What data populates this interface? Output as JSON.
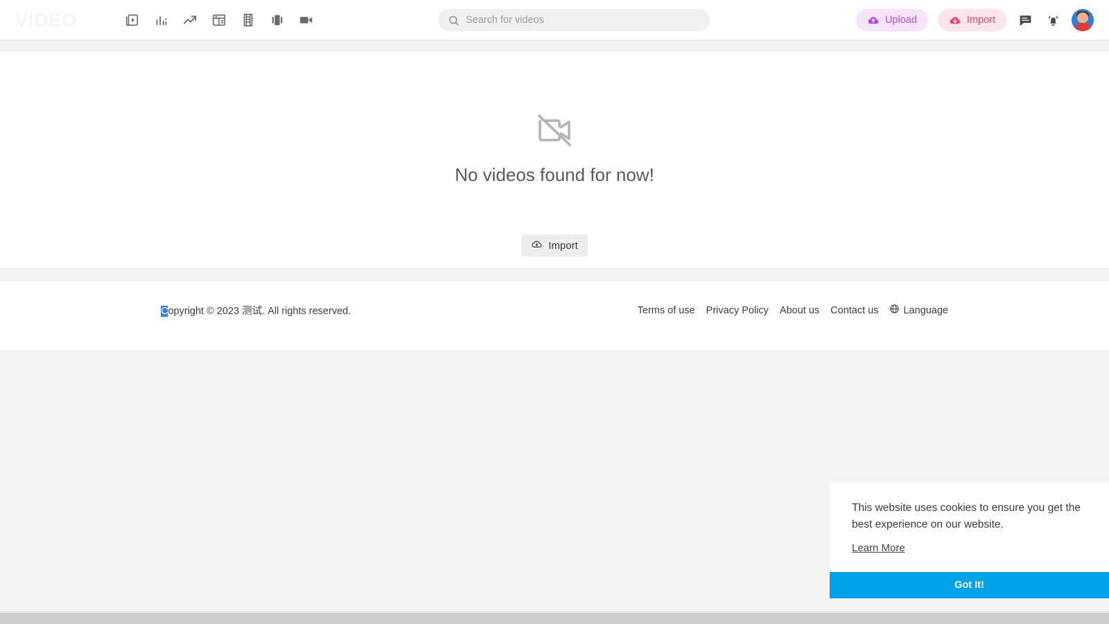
{
  "header": {
    "logo_text": "VIDEO",
    "nav_items": [
      {
        "name": "video-library-icon",
        "label": "Videos"
      },
      {
        "name": "bar-chart-icon",
        "label": "Analytics"
      },
      {
        "name": "trending-up-icon",
        "label": "Trending"
      },
      {
        "name": "layout-dashboard-icon",
        "label": "Dashboard"
      },
      {
        "name": "film-strip-icon",
        "label": "Films"
      },
      {
        "name": "carousel-icon",
        "label": "Carousel"
      },
      {
        "name": "video-camera-icon",
        "label": "Live"
      }
    ],
    "search": {
      "placeholder": "Search for videos",
      "value": "",
      "icon": "search-icon"
    },
    "upload_label": "Upload",
    "upload_icon": "cloud-upload-icon",
    "upload_color": "#b14be0",
    "upload_bg": "#f6e4fb",
    "import_label": "Import",
    "import_icon": "cloud-download-icon",
    "import_color": "#ef3f74",
    "import_bg": "#fde5ee",
    "chat_icon": "chat-icon",
    "bell_icon": "bell-icon",
    "avatar_icon": "user-avatar"
  },
  "main": {
    "empty_icon": "video-off-icon",
    "empty_message": "No videos found for now!",
    "import_button_label": "Import",
    "import_button_icon": "cloud-download-icon"
  },
  "footer": {
    "copyright_selected": "C",
    "copyright_rest": "opyright © 2023 测试. All rights reserved.",
    "links": [
      {
        "label": "Terms of use"
      },
      {
        "label": "Privacy Policy"
      },
      {
        "label": "About us"
      },
      {
        "label": "Contact us"
      }
    ],
    "language_label": "Language",
    "language_icon": "globe-icon"
  },
  "cookie_banner": {
    "message": "This website uses cookies to ensure you get the best experience on our website.",
    "learn_more_label": "Learn More",
    "accept_label": "Got It!",
    "accept_color": "#00a2e8"
  },
  "scrollbar": {
    "orientation": "horizontal"
  }
}
